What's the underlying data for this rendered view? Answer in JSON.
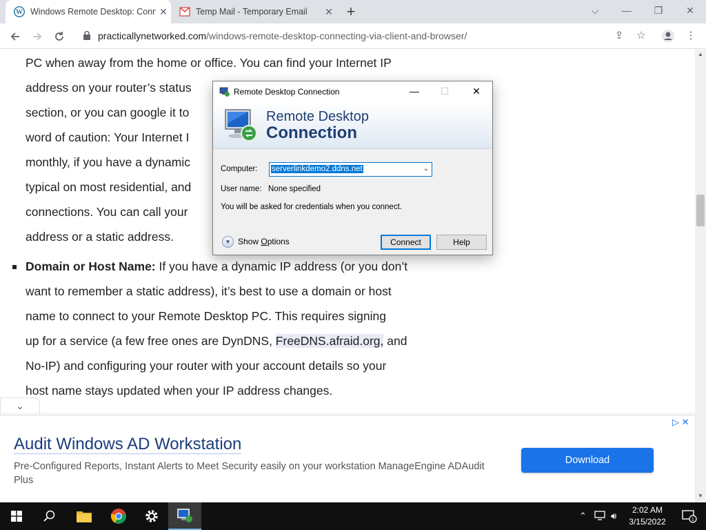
{
  "browser": {
    "tabs": [
      {
        "title": "Windows Remote Desktop: Conn",
        "icon": "wordpress-icon",
        "active": true
      },
      {
        "title": "Temp Mail - Temporary Email",
        "icon": "gmail-icon",
        "active": false
      }
    ],
    "url_host": "practicallynetworked.com",
    "url_path": "/windows-remote-desktop-connecting-via-client-and-browser/"
  },
  "article": {
    "lines_top": [
      "PC when away from the home or office. You can find your Internet IP",
      "address on your router’s status",
      "section, or you can google it to",
      "word of caution: Your Internet I",
      "monthly, if you have a dynamic",
      "typical on most residential, and",
      "connections. You can call your",
      "address or a static address."
    ],
    "bullet_bold": "Domain or Host Name:",
    "bullet_line1": " If you have a dynamic IP address (or you don’t",
    "bullet_lines": [
      "want to remember a static address), it’s best to use a domain or host",
      "name to connect to your Remote Desktop PC. This requires signing"
    ],
    "line_pre_link": "up for a service (a few free ones are DynDNS, ",
    "link": "FreeDNS.afraid.org,",
    "line_post_link": " and",
    "bullet_tail": [
      "No-IP) and configuring your router with your account details so your",
      "host name stays updated when your IP address changes."
    ]
  },
  "ad": {
    "title": "Audit Windows AD Workstation",
    "description": "Pre-Configured Reports, Instant Alerts to Meet Security easily on your workstation ManageEngine ADAudit Plus",
    "button": "Download"
  },
  "dialog": {
    "title": "Remote Desktop Connection",
    "banner_line1": "Remote Desktop",
    "banner_line2": "Connection",
    "computer_label": "Computer:",
    "computer_value": "serverlinkdemo2.ddns.net",
    "username_label": "User name:",
    "username_value": "None specified",
    "info": "You will be asked for credentials when you connect.",
    "show_options_prefix": "Show ",
    "show_options_access": "O",
    "show_options_suffix": "ptions",
    "connect": "Connect",
    "help": "Help"
  },
  "taskbar": {
    "time": "2:02 AM",
    "date": "3/15/2022",
    "notifications": "1"
  },
  "colors": {
    "accent": "#0078d7",
    "ad_button": "#1a73e8",
    "banner_text": "#1e3f74"
  }
}
